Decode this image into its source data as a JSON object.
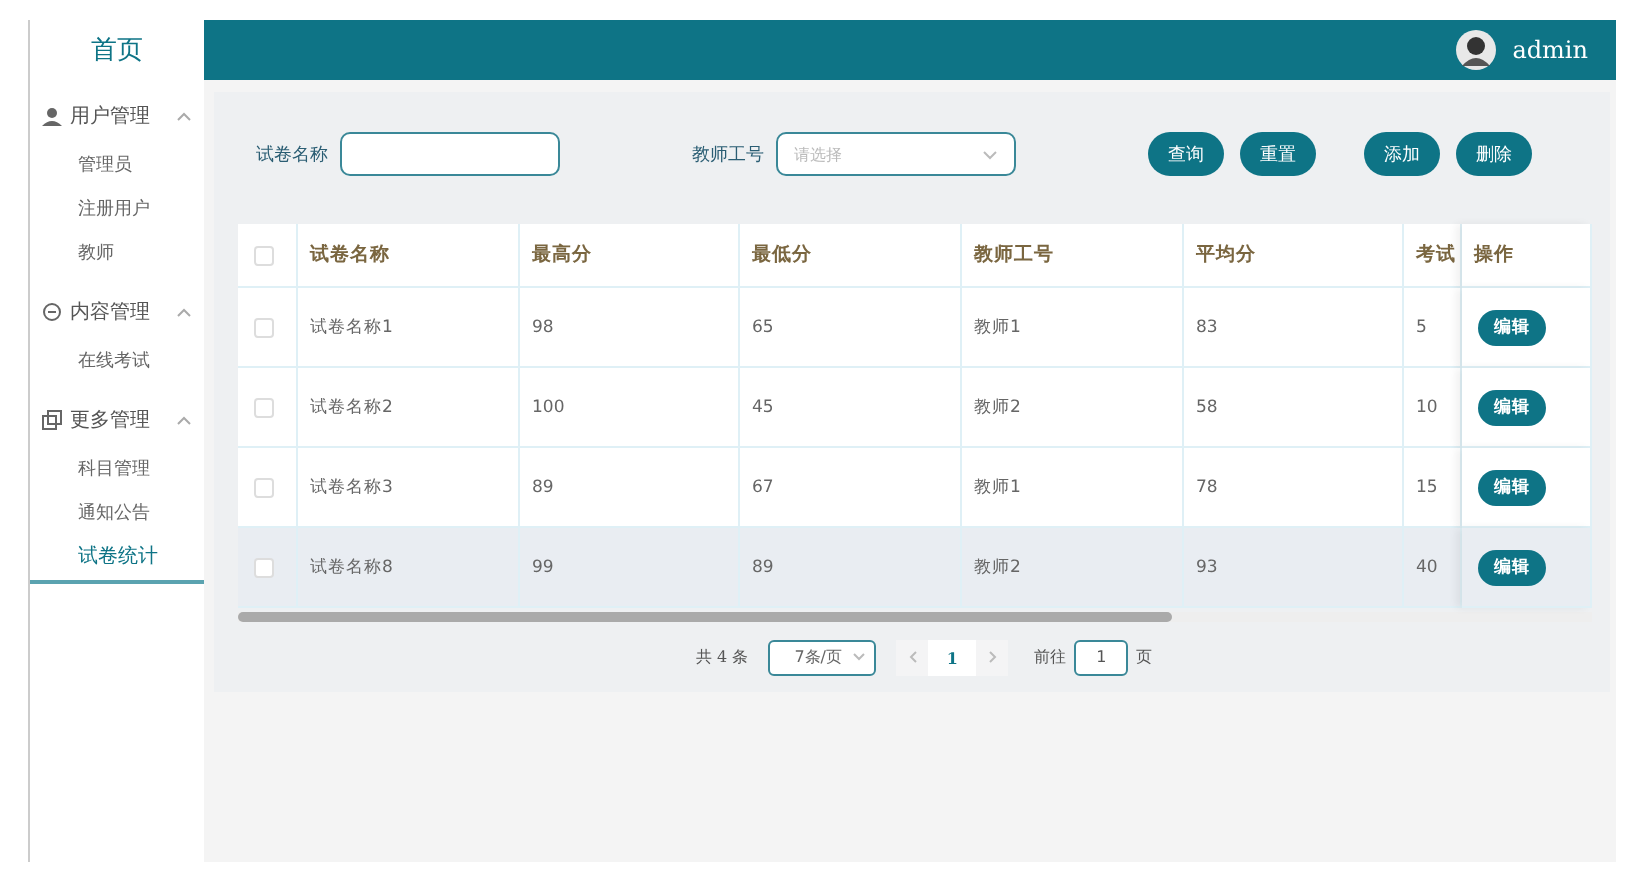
{
  "sidebar": {
    "title": "首页",
    "groups": [
      {
        "label": "用户管理",
        "expanded": true,
        "items": [
          {
            "label": "管理员",
            "selected": false
          },
          {
            "label": "注册用户",
            "selected": false
          },
          {
            "label": "教师",
            "selected": false
          }
        ]
      },
      {
        "label": "内容管理",
        "expanded": true,
        "items": [
          {
            "label": "在线考试",
            "selected": false
          }
        ]
      },
      {
        "label": "更多管理",
        "expanded": true,
        "items": [
          {
            "label": "科目管理",
            "selected": false
          },
          {
            "label": "通知公告",
            "selected": false
          },
          {
            "label": "试卷统计",
            "selected": true
          }
        ]
      }
    ]
  },
  "header": {
    "username": "admin"
  },
  "search": {
    "fields": [
      {
        "label": "试卷名称",
        "kind": "text"
      },
      {
        "label": "教师工号",
        "kind": "select",
        "placeholder": "请选择"
      }
    ],
    "buttons": [
      "查询",
      "重置",
      "添加",
      "删除"
    ]
  },
  "table": {
    "all_checked": false,
    "columns": [
      "试卷名称",
      "最高分",
      "最低分",
      "教师工号",
      "平均分",
      "考试",
      "操作"
    ],
    "rows": [
      {
        "checked": false,
        "hovered": false,
        "cells": [
          "试卷名称1",
          "98",
          "65",
          "教师1",
          "83",
          "5"
        ],
        "action": "编辑"
      },
      {
        "checked": false,
        "hovered": false,
        "cells": [
          "试卷名称2",
          "100",
          "45",
          "教师2",
          "58",
          "10"
        ],
        "action": "编辑"
      },
      {
        "checked": false,
        "hovered": false,
        "cells": [
          "试卷名称3",
          "89",
          "67",
          "教师1",
          "78",
          "15"
        ],
        "action": "编辑"
      },
      {
        "checked": false,
        "hovered": true,
        "cells": [
          "试卷名称8",
          "99",
          "89",
          "教师2",
          "93",
          "40"
        ],
        "action": "编辑"
      }
    ]
  },
  "pager": {
    "total": "共 4 条",
    "page_size": "7条/页",
    "current": "1",
    "goto_label": "前往",
    "goto_value": "1",
    "page_unit": "页"
  }
}
